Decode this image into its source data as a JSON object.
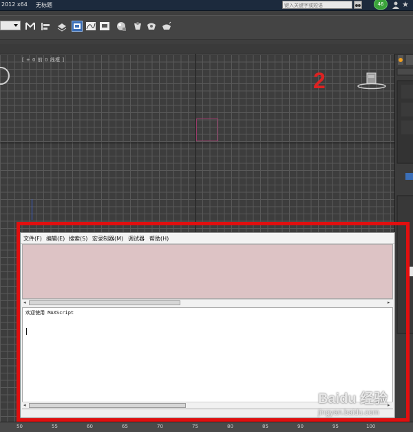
{
  "titlebar": {
    "version": "2012 x64",
    "doc_title": "无标题",
    "search_placeholder": "键入关键字或短语",
    "badge": "46"
  },
  "viewport": {
    "label": "[ + 0 前 0 线框 ]",
    "annotation": "2"
  },
  "ruler": {
    "ticks": [
      "50",
      "55",
      "60",
      "65",
      "70",
      "75",
      "80",
      "85",
      "90",
      "95",
      "100"
    ]
  },
  "maxscript": {
    "menu": [
      "文件(F)",
      "编辑(E)",
      "搜索(S)",
      "宏录制器(M)",
      "调试器",
      "帮助(H)"
    ],
    "output_text": "欢迎使用 MAXScript"
  },
  "watermark": {
    "line1": "Baidu 经验",
    "line2": "jingyan.baidu.com"
  },
  "colors": {
    "highlight": "#e10f0f",
    "listener_bg": "#ddc3c5",
    "titlebar_bg": "#1c2a3d",
    "viewport_bg": "#3d3d3d"
  }
}
